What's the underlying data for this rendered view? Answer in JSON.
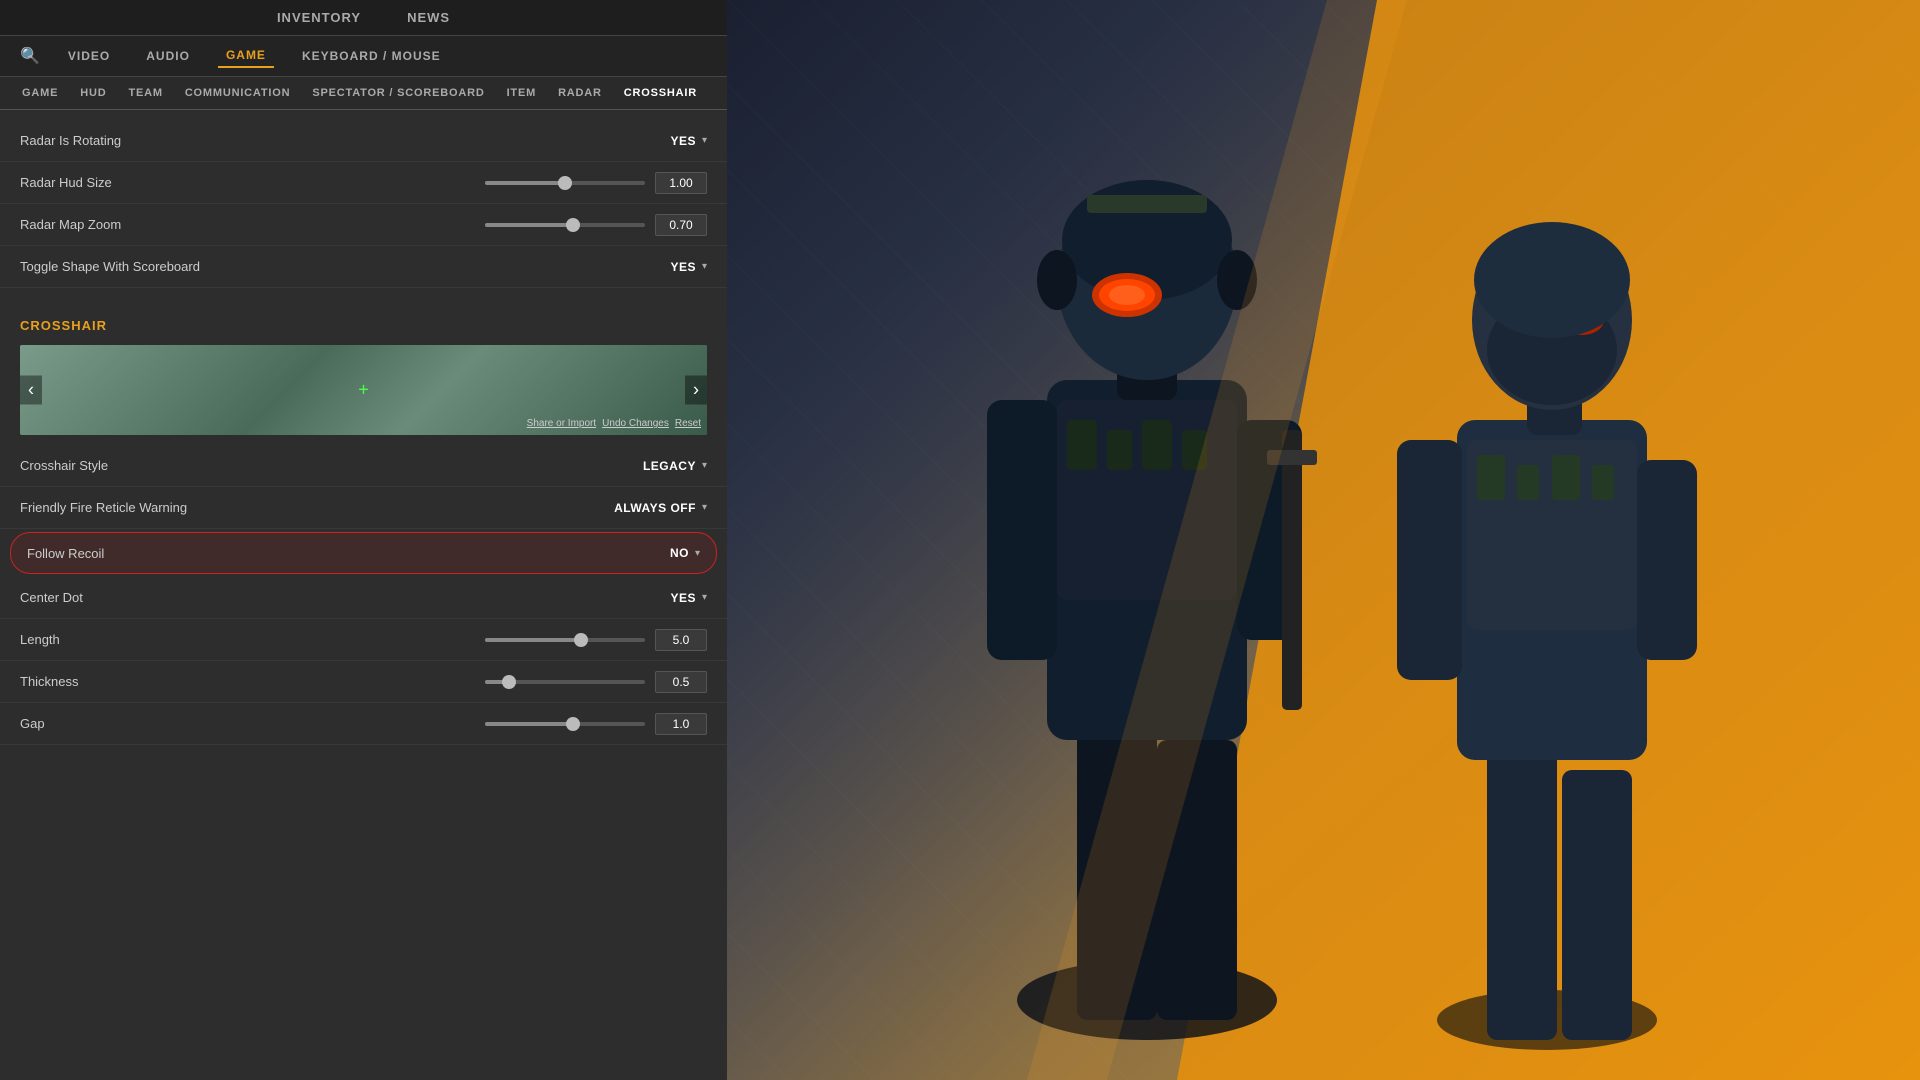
{
  "topNav": {
    "items": [
      {
        "id": "inventory",
        "label": "INVENTORY",
        "active": false
      },
      {
        "id": "news",
        "label": "NEWS",
        "active": false
      }
    ]
  },
  "settingsTabs": {
    "searchPlaceholder": "Search",
    "tabs": [
      {
        "id": "video",
        "label": "VIDEO",
        "active": false
      },
      {
        "id": "audio",
        "label": "AUDIO",
        "active": false
      },
      {
        "id": "game",
        "label": "GAME",
        "active": true
      },
      {
        "id": "keyboard-mouse",
        "label": "KEYBOARD / MOUSE",
        "active": false
      }
    ]
  },
  "subTabs": {
    "tabs": [
      {
        "id": "game",
        "label": "GAME",
        "active": false
      },
      {
        "id": "hud",
        "label": "HUD",
        "active": false
      },
      {
        "id": "team",
        "label": "TEAM",
        "active": false
      },
      {
        "id": "communication",
        "label": "COMMUNICATION",
        "active": false
      },
      {
        "id": "spectator-scoreboard",
        "label": "SPECTATOR / SCOREBOARD",
        "active": false
      },
      {
        "id": "item",
        "label": "ITEM",
        "active": false
      },
      {
        "id": "radar",
        "label": "RADAR",
        "active": false
      },
      {
        "id": "crosshair",
        "label": "CROSSHAIR",
        "active": true
      }
    ]
  },
  "settings": {
    "radarSection": [
      {
        "id": "radar-is-rotating",
        "label": "Radar Is Rotating",
        "type": "dropdown",
        "value": "YES"
      },
      {
        "id": "radar-hud-size",
        "label": "Radar Hud Size",
        "type": "slider",
        "sliderPercent": 50,
        "thumbPercent": 50,
        "value": "1.00"
      },
      {
        "id": "radar-map-zoom",
        "label": "Radar Map Zoom",
        "type": "slider",
        "sliderPercent": 55,
        "thumbPercent": 55,
        "value": "0.70"
      },
      {
        "id": "toggle-shape-scoreboard",
        "label": "Toggle Shape With Scoreboard",
        "type": "dropdown",
        "value": "YES"
      }
    ],
    "crosshairSection": {
      "header": "Crosshair",
      "preview": {
        "shareLabel": "Share or Import",
        "undoLabel": "Undo Changes",
        "resetLabel": "Reset",
        "navLeft": "‹",
        "navRight": "›"
      },
      "rows": [
        {
          "id": "crosshair-style",
          "label": "Crosshair Style",
          "type": "dropdown",
          "value": "LEGACY"
        },
        {
          "id": "friendly-fire-reticle-warning",
          "label": "Friendly Fire Reticle Warning",
          "type": "dropdown",
          "value": "ALWAYS OFF"
        },
        {
          "id": "follow-recoil",
          "label": "Follow Recoil",
          "type": "dropdown",
          "value": "NO",
          "highlighted": true
        },
        {
          "id": "center-dot",
          "label": "Center Dot",
          "type": "dropdown",
          "value": "YES"
        },
        {
          "id": "length",
          "label": "Length",
          "type": "slider",
          "sliderPercent": 60,
          "thumbPercent": 60,
          "value": "5.0"
        },
        {
          "id": "thickness",
          "label": "Thickness",
          "type": "slider",
          "sliderPercent": 15,
          "thumbPercent": 15,
          "value": "0.5"
        },
        {
          "id": "gap",
          "label": "Gap",
          "type": "slider",
          "sliderPercent": 55,
          "thumbPercent": 55,
          "value": "1.0"
        }
      ]
    }
  },
  "icons": {
    "search": "🔍",
    "chevronDown": "▾",
    "arrowLeft": "❮",
    "arrowRight": "❯",
    "crosshairSymbol": "+"
  }
}
